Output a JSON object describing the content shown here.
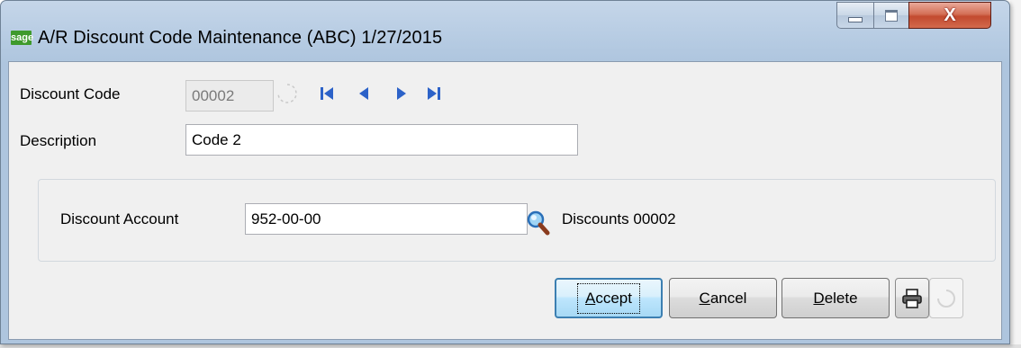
{
  "window": {
    "title": "A/R Discount Code Maintenance (ABC) 1/27/2015",
    "logo_text": "sage",
    "controls": {
      "close_glyph": "X"
    }
  },
  "form": {
    "discount_code": {
      "label": "Discount Code",
      "value": "00002"
    },
    "description": {
      "label": "Description",
      "value": "Code 2"
    },
    "discount_account": {
      "label": "Discount Account",
      "value": "952-00-00",
      "account_name": "Discounts 00002"
    }
  },
  "buttons": {
    "accept": {
      "access_key": "A",
      "rest": "ccept"
    },
    "cancel": {
      "access_key": "C",
      "rest": "ancel"
    },
    "delete": {
      "access_key": "D",
      "rest": "elete"
    }
  },
  "icons": {
    "nav": [
      "first-record-icon",
      "previous-record-icon",
      "next-record-icon",
      "last-record-icon"
    ],
    "lookup": "magnifier-icon",
    "print": "printer-icon",
    "refresh": "spinner-icon"
  },
  "colors": {
    "nav_arrow": "#2c62c8",
    "sage_green": "#3e9a2c",
    "close_red": "#c24a2f"
  }
}
